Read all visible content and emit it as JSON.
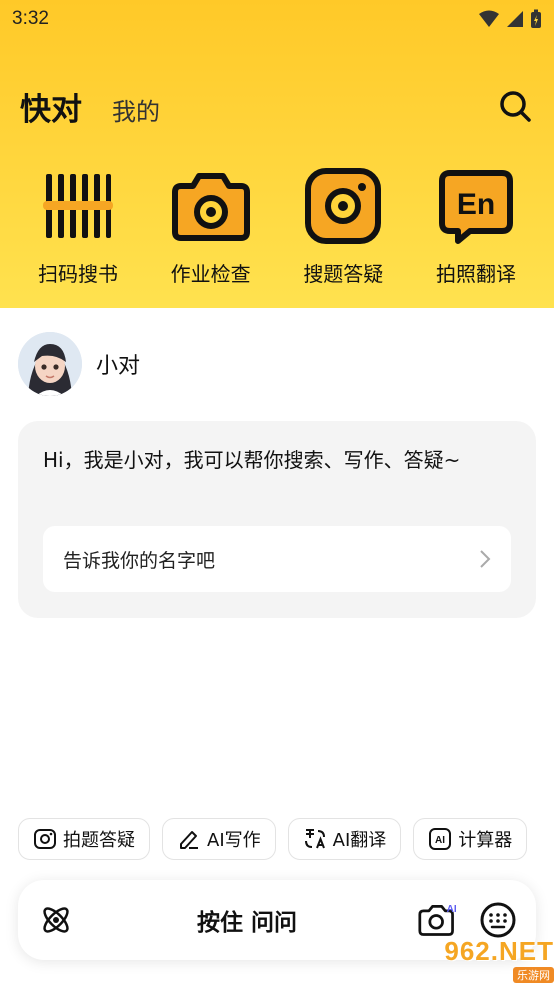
{
  "status_bar": {
    "time": "3:32"
  },
  "header": {
    "title": "快对",
    "tab_mine": "我的"
  },
  "tools": [
    {
      "label": "扫码搜书",
      "icon": "barcode-icon"
    },
    {
      "label": "作业检查",
      "icon": "camera-icon"
    },
    {
      "label": "搜题答疑",
      "icon": "photo-search-icon"
    },
    {
      "label": "拍照翻译",
      "icon": "translate-en-icon"
    }
  ],
  "chat": {
    "bot_name": "小对",
    "greeting": "Hi，我是小对，我可以帮你搜索、写作、答疑~",
    "suggestion": "告诉我你的名字吧"
  },
  "chips": [
    {
      "label": "拍题答疑",
      "icon": "camera-icon"
    },
    {
      "label": "AI写作",
      "icon": "pen-icon"
    },
    {
      "label": "AI翻译",
      "icon": "translate-icon"
    },
    {
      "label": "计算器",
      "icon": "ai-calculator-icon"
    }
  ],
  "input_bar": {
    "hold_label": "按住 问问",
    "camera_badge": "AI"
  },
  "watermark": {
    "big": "962.NET",
    "small": "乐游网"
  },
  "colors": {
    "accent_yellow": "#FFD43A",
    "icon_orange": "#F6A623"
  }
}
